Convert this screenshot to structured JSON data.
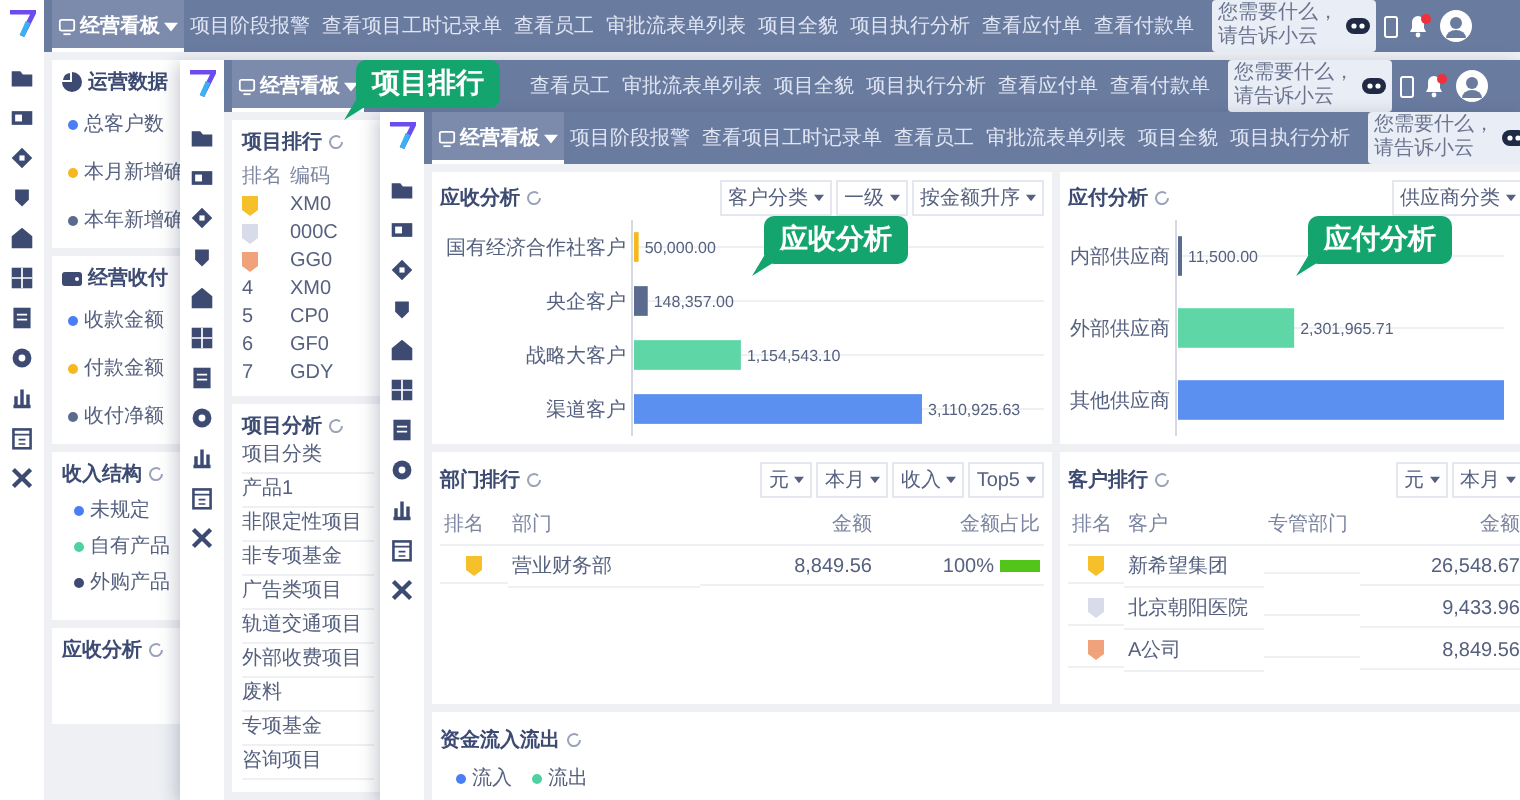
{
  "back_window": {
    "nav": [
      {
        "label": "经营看板",
        "selected": true
      },
      {
        "label": "项目阶段报警",
        "selected": false
      },
      {
        "label": "查看项目工时记录单",
        "selected": false
      },
      {
        "label": "查看员工",
        "selected": false
      },
      {
        "label": "审批流表单列表",
        "selected": false
      },
      {
        "label": "项目全貌",
        "selected": false
      },
      {
        "label": "项目执行分析",
        "selected": false
      },
      {
        "label": "查看应付单",
        "selected": false
      },
      {
        "label": "查看付款单",
        "selected": false
      }
    ],
    "search": {
      "placeholder": "您需要什么，请告诉小云"
    },
    "panels": [
      {
        "kind": "stats",
        "title": "运营数据",
        "items": [
          {
            "label": "总客户数",
            "color": "#4a7ef5"
          },
          {
            "label": "本月新增确",
            "color": "#f5b81e"
          },
          {
            "label": "本年新增确",
            "color": "#5b6b90"
          }
        ]
      },
      {
        "kind": "stats",
        "title": "经营收付",
        "items": [
          {
            "label": "收款金额",
            "color": "#4a7ef5"
          },
          {
            "label": "付款金额",
            "color": "#f5b81e"
          },
          {
            "label": "收付净额",
            "color": "#5b6b90"
          }
        ]
      },
      {
        "kind": "legend",
        "title": "收入结构",
        "items": [
          {
            "label": "未规定",
            "color": "#4a7ef5"
          },
          {
            "label": "自有产品",
            "color": "#4fd1a1"
          },
          {
            "label": "外购产品",
            "color": "#3d4b73"
          }
        ]
      },
      {
        "kind": "legend",
        "title": "应收分析"
      }
    ]
  },
  "middle_window": {
    "nav": [
      {
        "label": "经营看板",
        "selected": true
      },
      {
        "label": "查看员工",
        "selected": false
      },
      {
        "label": "审批流表单列表",
        "selected": false
      },
      {
        "label": "项目全貌",
        "selected": false
      },
      {
        "label": "项目执行分析",
        "selected": false
      },
      {
        "label": "查看应付单",
        "selected": false
      },
      {
        "label": "查看付款单",
        "selected": false
      }
    ],
    "search": {
      "placeholder": "您需要什么，请告诉小云"
    },
    "ranking": {
      "title": "项目排行",
      "columns": [
        "排名",
        "编码"
      ],
      "rows": [
        {
          "kind": "medal",
          "color": "#f5c02a",
          "code": "XM0"
        },
        {
          "kind": "medal",
          "color": "#d8dcea",
          "code": "000C"
        },
        {
          "kind": "medal",
          "color": "#f0a27a",
          "code": "GG0"
        },
        {
          "kind": "number",
          "rank": "4",
          "code": "XM0"
        },
        {
          "kind": "number",
          "rank": "5",
          "code": "CP0"
        },
        {
          "kind": "number",
          "rank": "6",
          "code": "GF0"
        },
        {
          "kind": "number",
          "rank": "7",
          "code": "GDY"
        }
      ]
    },
    "analysis": {
      "title": "项目分析",
      "items": [
        "项目分类",
        "产品1",
        "非限定性项目",
        "非专项基金",
        "广告类项目",
        "轨道交通项目",
        "外部收费项目",
        "废料",
        "专项基金",
        "咨询项目"
      ]
    }
  },
  "front_window": {
    "nav": [
      {
        "label": "经营看板",
        "selected": true
      },
      {
        "label": "项目阶段报警",
        "selected": false
      },
      {
        "label": "查看项目工时记录单",
        "selected": false
      },
      {
        "label": "查看员工",
        "selected": false
      },
      {
        "label": "审批流表单列表",
        "selected": false
      },
      {
        "label": "项目全貌",
        "selected": false
      },
      {
        "label": "项目执行分析",
        "selected": false
      }
    ],
    "search": {
      "placeholder": "您需要什么，请告诉小云"
    },
    "receivable": {
      "title": "应收分析",
      "filters": [
        "客户分类",
        "一级",
        "按金额升序"
      ],
      "chart_data": {
        "type": "bar",
        "orientation": "horizontal",
        "categories": [
          "国有经济合作社客户",
          "央企客户",
          "战略大客户",
          "渠道客户"
        ],
        "values": [
          50000,
          148357,
          1154543.1,
          3110925.63
        ],
        "value_labels": [
          "50,000.00",
          "148,357.00",
          "1,154,543.10",
          "3,110,925.63"
        ],
        "colors": [
          "#f5b81e",
          "#5b6b90",
          "#5fd6a6",
          "#5b8ff0"
        ]
      }
    },
    "payable": {
      "title": "应付分析",
      "filters": [
        "供应商分类"
      ],
      "chart_data": {
        "type": "bar",
        "orientation": "horizontal",
        "categories": [
          "内部供应商",
          "外部供应商",
          "其他供应商"
        ],
        "xlim": [
          0,
          6500000
        ],
        "values": [
          11500,
          2301965.71,
          6500000
        ],
        "value_labels": [
          "11,500.00",
          "2,301,965.71",
          null
        ],
        "colors": [
          "#5b6b90",
          "#5fd6a6",
          "#5b8ff0"
        ]
      }
    },
    "dept_ranking": {
      "title": "部门排行",
      "filters": [
        "元",
        "本月",
        "收入",
        "Top5"
      ],
      "columns": [
        "排名",
        "部门",
        "金额",
        "金额占比"
      ],
      "rows": [
        {
          "color": "#f5c02a",
          "name": "营业财务部",
          "amount": "8,849.56",
          "share": "100%",
          "level": 1
        }
      ]
    },
    "customer_ranking": {
      "title": "客户排行",
      "filters": [
        "元",
        "本月"
      ],
      "columns": [
        "排名",
        "客户",
        "专管部门",
        "金额"
      ],
      "rows": [
        {
          "color": "#f5c02a",
          "name": "新希望集团",
          "amount": "26,548.67"
        },
        {
          "color": "#d8dcea",
          "name": "北京朝阳医院",
          "amount": "9,433.96"
        },
        {
          "color": "#f0a27a",
          "name": "A公司",
          "amount": "8,849.56"
        }
      ]
    },
    "cashflow": {
      "title": "资金流入流出",
      "legend": [
        {
          "label": "流入",
          "color": "#4a7ef5"
        },
        {
          "label": "流出",
          "color": "#4fd1a1"
        }
      ]
    }
  },
  "callouts": [
    {
      "text": "项目排行"
    },
    {
      "text": "应收分析"
    },
    {
      "text": "应付分析"
    }
  ]
}
